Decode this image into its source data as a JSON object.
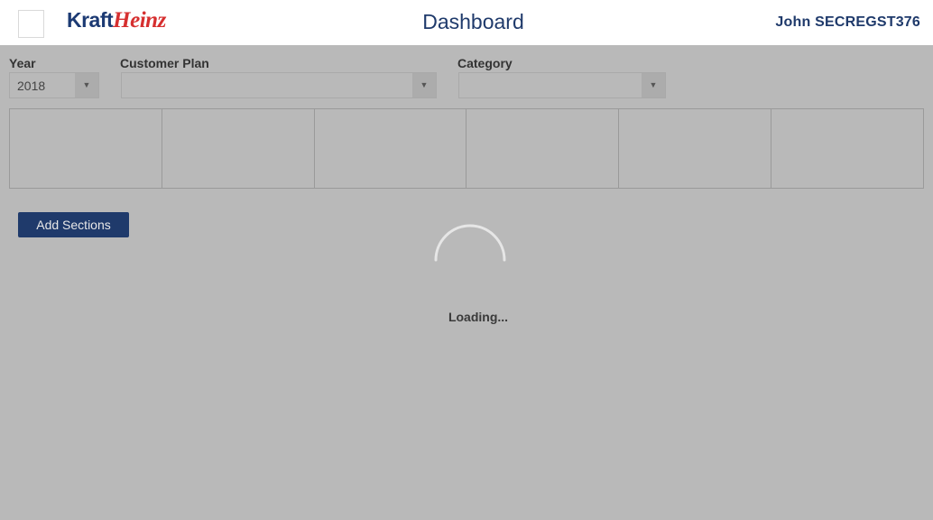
{
  "header": {
    "logo_part1": "Kraft",
    "logo_part2": "Heinz",
    "title": "Dashboard",
    "user_name": "John SECREGST376"
  },
  "filters": {
    "year": {
      "label": "Year",
      "value": "2018"
    },
    "customer_plan": {
      "label": "Customer Plan",
      "value": ""
    },
    "category": {
      "label": "Category",
      "value": ""
    }
  },
  "kpi_cards": [
    "",
    "",
    "",
    "",
    "",
    ""
  ],
  "actions": {
    "add_sections_label": "Add Sections"
  },
  "loading": {
    "text": "Loading..."
  },
  "colors": {
    "brand_navy": "#1f3a6b",
    "brand_red": "#d62f2f",
    "overlay_gray": "#b9b9b9"
  }
}
